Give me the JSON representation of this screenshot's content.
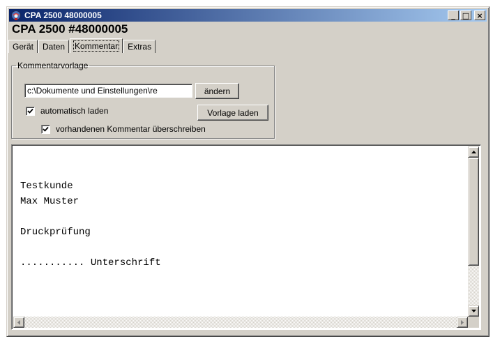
{
  "window": {
    "title": "CPA 2500 48000005",
    "minimize_glyph": "_",
    "maximize_glyph": "□",
    "close_glyph": "×"
  },
  "heading": "CPA 2500 #48000005",
  "tabs": [
    {
      "label": "Gerät",
      "active": false
    },
    {
      "label": "Daten",
      "active": false
    },
    {
      "label": "Kommentar",
      "active": true
    },
    {
      "label": "Extras",
      "active": false
    }
  ],
  "template_group": {
    "legend": "Kommentarvorlage",
    "path_value": "c:\\Dokumente und Einstellungen\\re",
    "change_button": "ändern",
    "autoload_label": "automatisch laden",
    "autoload_checked": true,
    "load_button": "Vorlage laden",
    "overwrite_label": "vorhandenen Kommentar überschreiben",
    "overwrite_checked": true
  },
  "comment_text": "Testkunde\nMax Muster\n\nDruckprüfung\n\n........... Unterschrift"
}
